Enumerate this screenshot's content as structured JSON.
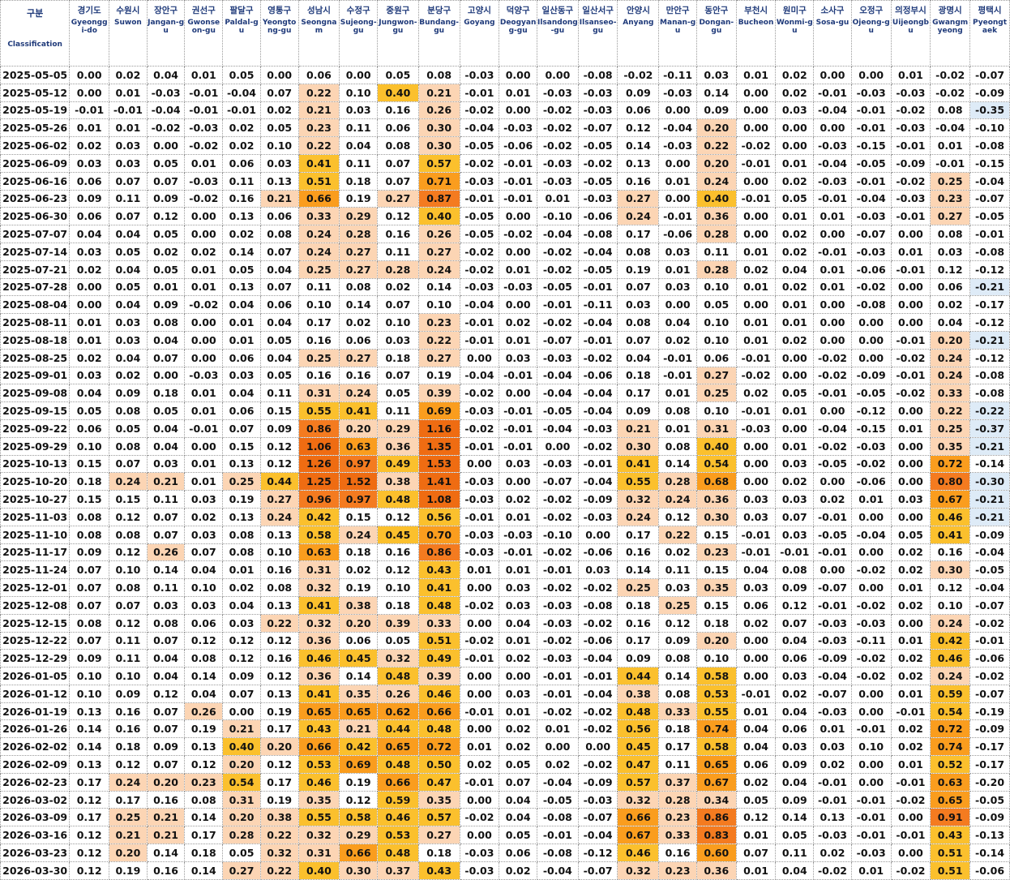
{
  "columns": [
    {
      "ko": "구분",
      "en": "Classification"
    },
    {
      "ko": "경기도",
      "en": "Gyeonggi-do"
    },
    {
      "ko": "수원시",
      "en": "Suwon"
    },
    {
      "ko": "장안구",
      "en": "Jangan-gu"
    },
    {
      "ko": "권선구",
      "en": "Gwonseon-gu"
    },
    {
      "ko": "팔달구",
      "en": "Paldal-gu"
    },
    {
      "ko": "영통구",
      "en": "Yeongtong-gu"
    },
    {
      "ko": "성남시",
      "en": "Seongnam"
    },
    {
      "ko": "수정구",
      "en": "Sujeong-gu"
    },
    {
      "ko": "중원구",
      "en": "Jungwon-gu"
    },
    {
      "ko": "분당구",
      "en": "Bundang-gu"
    },
    {
      "ko": "고양시",
      "en": "Goyang"
    },
    {
      "ko": "덕양구",
      "en": "Deogyang-gu"
    },
    {
      "ko": "일산동구",
      "en": "Ilsandong-gu"
    },
    {
      "ko": "일산서구",
      "en": "Ilsanseo-gu"
    },
    {
      "ko": "안양시",
      "en": "Anyang"
    },
    {
      "ko": "만안구",
      "en": "Manan-gu"
    },
    {
      "ko": "동안구",
      "en": "Dongan-gu"
    },
    {
      "ko": "부천시",
      "en": "Bucheon"
    },
    {
      "ko": "원미구",
      "en": "Wonmi-gu"
    },
    {
      "ko": "소사구",
      "en": "Sosa-gu"
    },
    {
      "ko": "오정구",
      "en": "Ojeong-gu"
    },
    {
      "ko": "의정부시",
      "en": "Uijeongbu"
    },
    {
      "ko": "광명시",
      "en": "Gwangmyeong"
    },
    {
      "ko": "평택시",
      "en": "Pyeongtaek"
    }
  ],
  "rows": [
    [
      "2025-05-05",
      "0.00",
      "0.02",
      "0.04",
      "0.01",
      "0.05",
      "0.00",
      "0.06",
      "0.00",
      "0.05",
      "0.08",
      "-0.03",
      "0.00",
      "0.00",
      "-0.08",
      "-0.02",
      "-0.11",
      "0.03",
      "0.01",
      "0.02",
      "0.00",
      "0.00",
      "0.01",
      "-0.02",
      "-0.07"
    ],
    [
      "2025-05-12",
      "0.00",
      "0.01",
      "-0.03",
      "-0.01",
      "-0.04",
      "0.07",
      "0.22",
      "0.10",
      "0.40",
      "0.21",
      "-0.01",
      "0.01",
      "-0.03",
      "-0.03",
      "0.09",
      "-0.03",
      "0.14",
      "0.00",
      "0.02",
      "-0.01",
      "-0.03",
      "-0.03",
      "-0.02",
      "-0.09"
    ],
    [
      "2025-05-19",
      "-0.01",
      "-0.01",
      "-0.04",
      "-0.01",
      "-0.01",
      "0.02",
      "0.21",
      "0.03",
      "0.16",
      "0.26",
      "-0.02",
      "0.00",
      "-0.02",
      "-0.03",
      "0.06",
      "0.00",
      "0.09",
      "0.00",
      "0.03",
      "-0.04",
      "-0.01",
      "-0.02",
      "0.08",
      "-0.35"
    ],
    [
      "2025-05-26",
      "0.01",
      "0.01",
      "-0.02",
      "-0.03",
      "0.02",
      "0.05",
      "0.23",
      "0.11",
      "0.06",
      "0.30",
      "-0.04",
      "-0.03",
      "-0.02",
      "-0.07",
      "0.12",
      "-0.04",
      "0.20",
      "0.00",
      "0.00",
      "0.00",
      "-0.01",
      "-0.03",
      "-0.04",
      "-0.10"
    ],
    [
      "2025-06-02",
      "0.02",
      "0.03",
      "0.00",
      "-0.02",
      "0.02",
      "0.10",
      "0.22",
      "0.04",
      "0.08",
      "0.30",
      "-0.05",
      "-0.06",
      "-0.02",
      "-0.05",
      "0.14",
      "-0.03",
      "0.22",
      "-0.02",
      "0.00",
      "-0.03",
      "-0.15",
      "-0.01",
      "0.01",
      "-0.08"
    ],
    [
      "2025-06-09",
      "0.03",
      "0.03",
      "0.05",
      "0.01",
      "0.06",
      "0.03",
      "0.41",
      "0.11",
      "0.07",
      "0.57",
      "-0.02",
      "-0.01",
      "-0.03",
      "-0.02",
      "0.13",
      "0.00",
      "0.20",
      "-0.01",
      "0.01",
      "-0.04",
      "-0.05",
      "-0.09",
      "-0.01",
      "-0.15"
    ],
    [
      "2025-06-16",
      "0.06",
      "0.07",
      "0.07",
      "-0.03",
      "0.11",
      "0.13",
      "0.51",
      "0.18",
      "0.07",
      "0.71",
      "-0.03",
      "-0.01",
      "-0.03",
      "-0.05",
      "0.16",
      "0.01",
      "0.24",
      "0.00",
      "0.02",
      "-0.03",
      "-0.01",
      "-0.02",
      "0.25",
      "-0.04"
    ],
    [
      "2025-06-23",
      "0.09",
      "0.11",
      "0.09",
      "-0.02",
      "0.16",
      "0.21",
      "0.66",
      "0.19",
      "0.27",
      "0.87",
      "-0.01",
      "-0.01",
      "0.01",
      "-0.03",
      "0.27",
      "0.00",
      "0.40",
      "-0.01",
      "0.05",
      "-0.01",
      "-0.04",
      "-0.03",
      "0.23",
      "-0.07"
    ],
    [
      "2025-06-30",
      "0.06",
      "0.07",
      "0.12",
      "0.00",
      "0.13",
      "0.06",
      "0.33",
      "0.29",
      "0.12",
      "0.40",
      "-0.05",
      "0.00",
      "-0.10",
      "-0.06",
      "0.24",
      "-0.01",
      "0.36",
      "0.00",
      "0.01",
      "0.01",
      "-0.03",
      "-0.01",
      "0.27",
      "-0.05"
    ],
    [
      "2025-07-07",
      "0.04",
      "0.04",
      "0.05",
      "0.00",
      "0.02",
      "0.08",
      "0.24",
      "0.28",
      "0.16",
      "0.26",
      "-0.05",
      "-0.02",
      "-0.04",
      "-0.08",
      "0.17",
      "-0.06",
      "0.28",
      "0.00",
      "0.02",
      "0.00",
      "-0.07",
      "0.00",
      "0.08",
      "-0.01"
    ],
    [
      "2025-07-14",
      "0.03",
      "0.05",
      "0.02",
      "0.02",
      "0.14",
      "0.07",
      "0.24",
      "0.27",
      "0.11",
      "0.27",
      "-0.02",
      "0.00",
      "-0.02",
      "-0.04",
      "0.08",
      "0.03",
      "0.11",
      "0.01",
      "0.02",
      "-0.01",
      "-0.03",
      "0.01",
      "0.03",
      "-0.08"
    ],
    [
      "2025-07-21",
      "0.02",
      "0.04",
      "0.05",
      "0.01",
      "0.05",
      "0.04",
      "0.25",
      "0.27",
      "0.28",
      "0.24",
      "-0.02",
      "0.01",
      "-0.02",
      "-0.05",
      "0.19",
      "0.01",
      "0.28",
      "0.02",
      "0.04",
      "0.01",
      "-0.06",
      "-0.01",
      "0.12",
      "-0.12"
    ],
    [
      "2025-07-28",
      "0.00",
      "0.05",
      "0.01",
      "0.01",
      "0.13",
      "0.07",
      "0.11",
      "0.08",
      "0.02",
      "0.14",
      "-0.03",
      "-0.03",
      "-0.05",
      "-0.01",
      "0.07",
      "0.03",
      "0.10",
      "0.01",
      "0.02",
      "0.01",
      "-0.02",
      "0.00",
      "0.06",
      "-0.21"
    ],
    [
      "2025-08-04",
      "0.00",
      "0.04",
      "0.09",
      "-0.02",
      "0.04",
      "0.06",
      "0.10",
      "0.14",
      "0.07",
      "0.10",
      "-0.04",
      "0.00",
      "-0.01",
      "-0.11",
      "0.03",
      "0.00",
      "0.05",
      "0.00",
      "0.01",
      "0.00",
      "-0.08",
      "0.00",
      "0.02",
      "-0.17"
    ],
    [
      "2025-08-11",
      "0.01",
      "0.03",
      "0.08",
      "0.00",
      "0.01",
      "0.04",
      "0.17",
      "0.02",
      "0.10",
      "0.23",
      "-0.01",
      "0.02",
      "-0.02",
      "-0.04",
      "0.08",
      "0.04",
      "0.10",
      "0.01",
      "0.01",
      "0.00",
      "0.00",
      "0.00",
      "0.04",
      "-0.12"
    ],
    [
      "2025-08-18",
      "0.01",
      "0.03",
      "0.04",
      "0.00",
      "0.01",
      "0.05",
      "0.16",
      "0.06",
      "0.03",
      "0.22",
      "-0.01",
      "0.01",
      "-0.07",
      "-0.01",
      "0.07",
      "0.02",
      "0.10",
      "0.01",
      "0.02",
      "0.00",
      "0.00",
      "-0.01",
      "0.20",
      "-0.21"
    ],
    [
      "2025-08-25",
      "0.02",
      "0.04",
      "0.07",
      "0.00",
      "0.06",
      "0.04",
      "0.25",
      "0.27",
      "0.18",
      "0.27",
      "0.00",
      "0.03",
      "-0.03",
      "-0.02",
      "0.04",
      "-0.01",
      "0.06",
      "-0.01",
      "0.00",
      "-0.02",
      "0.00",
      "-0.02",
      "0.24",
      "-0.12"
    ],
    [
      "2025-09-01",
      "0.03",
      "0.02",
      "0.00",
      "-0.03",
      "0.03",
      "0.05",
      "0.16",
      "0.16",
      "0.07",
      "0.19",
      "-0.04",
      "-0.01",
      "-0.04",
      "-0.06",
      "0.18",
      "-0.01",
      "0.27",
      "-0.02",
      "0.00",
      "-0.02",
      "-0.09",
      "-0.01",
      "0.24",
      "-0.08"
    ],
    [
      "2025-09-08",
      "0.04",
      "0.09",
      "0.18",
      "0.01",
      "0.04",
      "0.11",
      "0.31",
      "0.24",
      "0.05",
      "0.39",
      "-0.02",
      "0.00",
      "-0.04",
      "-0.04",
      "0.17",
      "0.01",
      "0.25",
      "0.02",
      "0.05",
      "-0.01",
      "-0.05",
      "-0.02",
      "0.33",
      "-0.08"
    ],
    [
      "2025-09-15",
      "0.05",
      "0.08",
      "0.05",
      "0.01",
      "0.06",
      "0.15",
      "0.55",
      "0.41",
      "0.11",
      "0.69",
      "-0.03",
      "-0.01",
      "-0.05",
      "-0.04",
      "0.09",
      "0.08",
      "0.10",
      "-0.01",
      "0.01",
      "0.00",
      "-0.12",
      "0.00",
      "0.22",
      "-0.22"
    ],
    [
      "2025-09-22",
      "0.06",
      "0.05",
      "0.04",
      "-0.01",
      "0.07",
      "0.09",
      "0.86",
      "0.20",
      "0.29",
      "1.16",
      "-0.02",
      "-0.01",
      "-0.04",
      "-0.03",
      "0.21",
      "0.01",
      "0.31",
      "-0.03",
      "0.00",
      "-0.04",
      "-0.15",
      "0.01",
      "0.25",
      "-0.37"
    ],
    [
      "2025-09-29",
      "0.10",
      "0.08",
      "0.04",
      "0.00",
      "0.15",
      "0.12",
      "1.06",
      "0.63",
      "0.36",
      "1.35",
      "-0.01",
      "-0.01",
      "0.00",
      "-0.02",
      "0.30",
      "0.08",
      "0.40",
      "0.00",
      "0.01",
      "-0.02",
      "-0.03",
      "0.00",
      "0.35",
      "-0.21"
    ],
    [
      "2025-10-13",
      "0.15",
      "0.07",
      "0.03",
      "0.01",
      "0.13",
      "0.12",
      "1.26",
      "0.97",
      "0.49",
      "1.53",
      "0.00",
      "0.03",
      "-0.03",
      "-0.01",
      "0.41",
      "0.14",
      "0.54",
      "0.00",
      "0.03",
      "-0.05",
      "-0.02",
      "0.00",
      "0.72",
      "-0.14"
    ],
    [
      "2025-10-20",
      "0.18",
      "0.24",
      "0.21",
      "0.01",
      "0.25",
      "0.44",
      "1.25",
      "1.52",
      "0.38",
      "1.41",
      "-0.03",
      "0.00",
      "-0.07",
      "-0.04",
      "0.55",
      "0.28",
      "0.68",
      "0.00",
      "0.02",
      "0.00",
      "-0.06",
      "0.00",
      "0.80",
      "-0.30"
    ],
    [
      "2025-10-27",
      "0.15",
      "0.15",
      "0.11",
      "0.03",
      "0.19",
      "0.27",
      "0.96",
      "0.97",
      "0.48",
      "1.08",
      "-0.03",
      "0.02",
      "-0.02",
      "-0.09",
      "0.32",
      "0.24",
      "0.36",
      "0.03",
      "0.03",
      "0.02",
      "0.01",
      "0.03",
      "0.67",
      "-0.21"
    ],
    [
      "2025-11-03",
      "0.08",
      "0.12",
      "0.07",
      "0.02",
      "0.13",
      "0.24",
      "0.42",
      "0.15",
      "0.12",
      "0.56",
      "-0.01",
      "0.01",
      "-0.02",
      "-0.03",
      "0.24",
      "0.12",
      "0.30",
      "0.03",
      "0.07",
      "-0.01",
      "0.00",
      "0.00",
      "0.46",
      "-0.21"
    ],
    [
      "2025-11-10",
      "0.08",
      "0.08",
      "0.07",
      "0.03",
      "0.08",
      "0.13",
      "0.58",
      "0.24",
      "0.45",
      "0.70",
      "-0.03",
      "-0.03",
      "-0.10",
      "0.00",
      "0.17",
      "0.22",
      "0.15",
      "-0.01",
      "0.03",
      "-0.05",
      "-0.04",
      "0.05",
      "0.41",
      "-0.09"
    ],
    [
      "2025-11-17",
      "0.09",
      "0.12",
      "0.26",
      "0.07",
      "0.08",
      "0.10",
      "0.63",
      "0.18",
      "0.16",
      "0.86",
      "-0.03",
      "-0.01",
      "-0.02",
      "-0.06",
      "0.16",
      "0.02",
      "0.23",
      "-0.01",
      "-0.01",
      "-0.01",
      "0.00",
      "0.02",
      "0.16",
      "-0.04"
    ],
    [
      "2025-11-24",
      "0.07",
      "0.10",
      "0.14",
      "0.04",
      "0.01",
      "0.16",
      "0.31",
      "0.02",
      "0.12",
      "0.43",
      "0.01",
      "0.01",
      "-0.01",
      "0.03",
      "0.14",
      "0.11",
      "0.15",
      "0.04",
      "0.08",
      "0.00",
      "-0.02",
      "0.02",
      "0.30",
      "-0.05"
    ],
    [
      "2025-12-01",
      "0.07",
      "0.08",
      "0.11",
      "0.10",
      "0.02",
      "0.08",
      "0.32",
      "0.19",
      "0.10",
      "0.41",
      "0.00",
      "0.03",
      "-0.02",
      "-0.02",
      "0.25",
      "0.03",
      "0.35",
      "0.03",
      "0.09",
      "-0.07",
      "0.00",
      "0.01",
      "0.12",
      "-0.04"
    ],
    [
      "2025-12-08",
      "0.07",
      "0.07",
      "0.03",
      "0.03",
      "0.04",
      "0.13",
      "0.41",
      "0.38",
      "0.18",
      "0.48",
      "-0.02",
      "0.03",
      "-0.03",
      "-0.08",
      "0.18",
      "0.25",
      "0.15",
      "0.06",
      "0.12",
      "-0.01",
      "-0.02",
      "0.02",
      "0.10",
      "-0.07"
    ],
    [
      "2025-12-15",
      "0.08",
      "0.12",
      "0.08",
      "0.06",
      "0.03",
      "0.22",
      "0.32",
      "0.20",
      "0.39",
      "0.33",
      "0.00",
      "0.04",
      "-0.03",
      "-0.02",
      "0.16",
      "0.12",
      "0.18",
      "0.02",
      "0.07",
      "-0.03",
      "-0.03",
      "0.00",
      "0.24",
      "-0.02"
    ],
    [
      "2025-12-22",
      "0.07",
      "0.11",
      "0.07",
      "0.12",
      "0.12",
      "0.12",
      "0.36",
      "0.06",
      "0.05",
      "0.51",
      "-0.02",
      "0.01",
      "-0.02",
      "-0.06",
      "0.17",
      "0.09",
      "0.20",
      "0.00",
      "0.04",
      "-0.03",
      "-0.11",
      "0.01",
      "0.42",
      "-0.01"
    ],
    [
      "2025-12-29",
      "0.09",
      "0.11",
      "0.04",
      "0.08",
      "0.12",
      "0.16",
      "0.46",
      "0.45",
      "0.32",
      "0.49",
      "-0.01",
      "0.02",
      "-0.03",
      "-0.04",
      "0.09",
      "0.08",
      "0.10",
      "0.00",
      "0.06",
      "-0.09",
      "-0.02",
      "0.02",
      "0.46",
      "-0.06"
    ],
    [
      "2026-01-05",
      "0.10",
      "0.10",
      "0.04",
      "0.14",
      "0.09",
      "0.12",
      "0.36",
      "0.14",
      "0.48",
      "0.39",
      "0.00",
      "0.00",
      "-0.01",
      "-0.01",
      "0.44",
      "0.14",
      "0.58",
      "0.00",
      "0.03",
      "-0.04",
      "-0.02",
      "0.02",
      "0.24",
      "-0.02"
    ],
    [
      "2026-01-12",
      "0.10",
      "0.09",
      "0.12",
      "0.04",
      "0.07",
      "0.13",
      "0.41",
      "0.35",
      "0.26",
      "0.46",
      "0.00",
      "0.03",
      "-0.01",
      "-0.04",
      "0.38",
      "0.08",
      "0.53",
      "-0.01",
      "0.02",
      "-0.07",
      "0.00",
      "0.01",
      "0.59",
      "-0.07"
    ],
    [
      "2026-01-19",
      "0.13",
      "0.16",
      "0.07",
      "0.26",
      "0.00",
      "0.19",
      "0.65",
      "0.65",
      "0.62",
      "0.66",
      "-0.01",
      "0.01",
      "-0.02",
      "-0.02",
      "0.48",
      "0.33",
      "0.55",
      "0.01",
      "0.04",
      "-0.03",
      "0.00",
      "-0.01",
      "0.54",
      "-0.19"
    ],
    [
      "2026-01-26",
      "0.14",
      "0.16",
      "0.07",
      "0.19",
      "0.21",
      "0.17",
      "0.43",
      "0.21",
      "0.44",
      "0.48",
      "0.00",
      "0.02",
      "0.01",
      "-0.02",
      "0.56",
      "0.18",
      "0.74",
      "0.04",
      "0.06",
      "0.01",
      "-0.01",
      "0.02",
      "0.72",
      "-0.09"
    ],
    [
      "2026-02-02",
      "0.14",
      "0.18",
      "0.09",
      "0.13",
      "0.40",
      "0.20",
      "0.66",
      "0.42",
      "0.65",
      "0.72",
      "0.01",
      "0.02",
      "0.00",
      "0.00",
      "0.45",
      "0.17",
      "0.58",
      "0.04",
      "0.03",
      "0.03",
      "0.10",
      "0.02",
      "0.74",
      "-0.17"
    ],
    [
      "2026-02-09",
      "0.13",
      "0.12",
      "0.07",
      "0.12",
      "0.20",
      "0.12",
      "0.53",
      "0.69",
      "0.48",
      "0.50",
      "0.02",
      "0.05",
      "0.02",
      "-0.02",
      "0.47",
      "0.11",
      "0.65",
      "0.06",
      "0.09",
      "0.02",
      "0.00",
      "0.01",
      "0.52",
      "-0.17"
    ],
    [
      "2026-02-23",
      "0.17",
      "0.24",
      "0.20",
      "0.23",
      "0.54",
      "0.17",
      "0.46",
      "0.19",
      "0.66",
      "0.47",
      "-0.01",
      "0.07",
      "-0.04",
      "-0.09",
      "0.57",
      "0.37",
      "0.67",
      "0.02",
      "0.04",
      "-0.01",
      "0.00",
      "-0.01",
      "0.63",
      "-0.20"
    ],
    [
      "2026-03-02",
      "0.12",
      "0.17",
      "0.16",
      "0.08",
      "0.31",
      "0.19",
      "0.35",
      "0.12",
      "0.59",
      "0.35",
      "0.00",
      "0.04",
      "-0.05",
      "-0.03",
      "0.32",
      "0.28",
      "0.34",
      "0.05",
      "0.09",
      "-0.01",
      "-0.01",
      "-0.02",
      "0.65",
      "-0.05"
    ],
    [
      "2026-03-09",
      "0.17",
      "0.25",
      "0.21",
      "0.14",
      "0.20",
      "0.38",
      "0.55",
      "0.58",
      "0.46",
      "0.57",
      "-0.02",
      "0.04",
      "-0.08",
      "-0.07",
      "0.66",
      "0.23",
      "0.86",
      "0.12",
      "0.14",
      "0.13",
      "-0.01",
      "0.00",
      "0.91",
      "-0.09"
    ],
    [
      "2026-03-16",
      "0.12",
      "0.21",
      "0.21",
      "0.17",
      "0.28",
      "0.22",
      "0.32",
      "0.29",
      "0.53",
      "0.27",
      "0.00",
      "0.05",
      "-0.01",
      "-0.04",
      "0.67",
      "0.33",
      "0.83",
      "0.01",
      "0.05",
      "-0.03",
      "-0.01",
      "-0.01",
      "0.43",
      "-0.13"
    ],
    [
      "2026-03-23",
      "0.12",
      "0.20",
      "0.14",
      "0.18",
      "0.05",
      "0.32",
      "0.31",
      "0.66",
      "0.48",
      "0.18",
      "-0.03",
      "0.06",
      "-0.08",
      "-0.12",
      "0.46",
      "0.16",
      "0.60",
      "0.07",
      "0.11",
      "0.02",
      "-0.03",
      "0.00",
      "0.51",
      "-0.14"
    ],
    [
      "2026-03-30",
      "0.12",
      "0.19",
      "0.16",
      "0.14",
      "0.27",
      "0.22",
      "0.40",
      "0.30",
      "0.37",
      "0.43",
      "-0.03",
      "0.02",
      "-0.04",
      "-0.07",
      "0.32",
      "0.23",
      "0.36",
      "0.01",
      "0.04",
      "-0.02",
      "0.01",
      "-0.02",
      "0.51",
      "-0.06"
    ]
  ],
  "heat_colors": {
    "level1": "#fcd5b4",
    "level2": "#fbc02d",
    "level3": "#fa9d1e",
    "level4": "#f47b20",
    "level5": "#ef6c12",
    "negative": "#deebf7"
  }
}
